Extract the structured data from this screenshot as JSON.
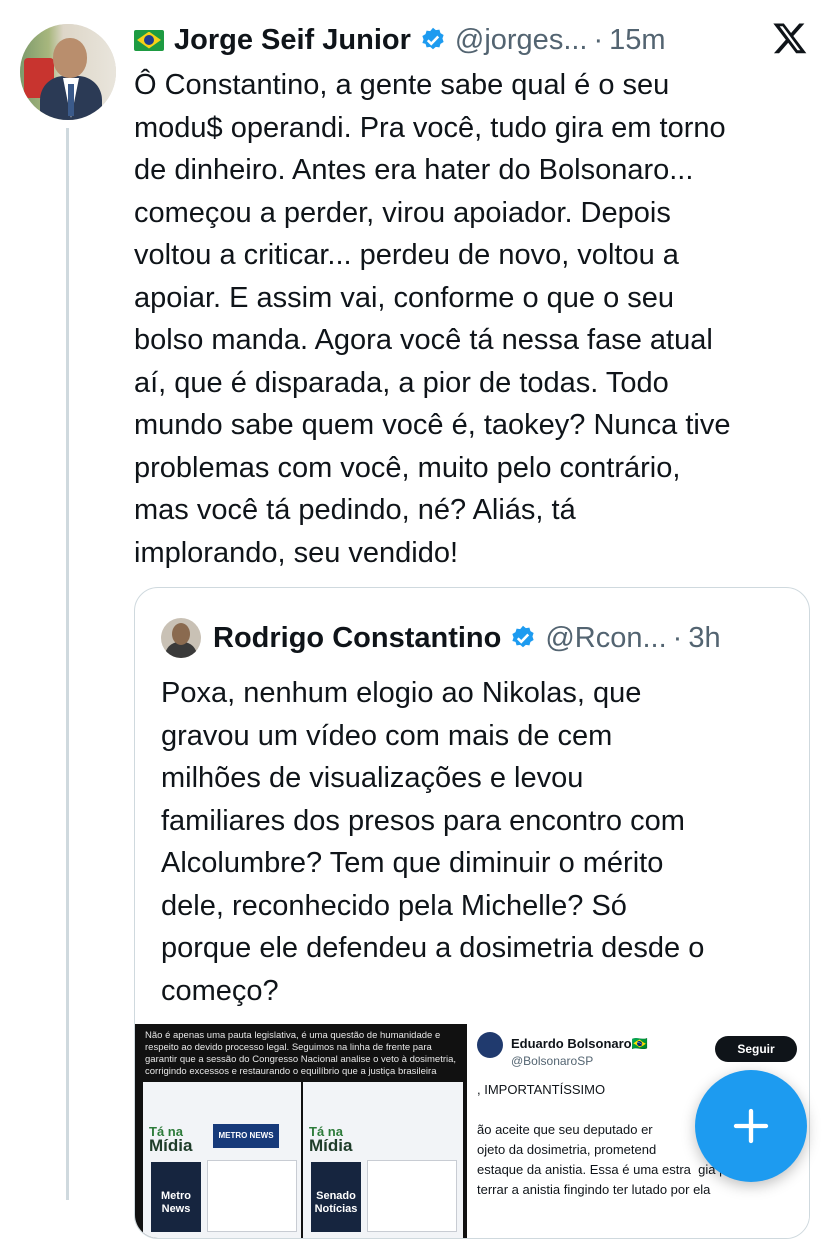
{
  "tweet": {
    "flag": "🇧🇷",
    "author_name": "Jorge Seif Junior",
    "handle": "@jorges...",
    "separator": "·",
    "time": "15m",
    "text": "Ô Constantino, a gente sabe qual é o seu\nmodu$ operandi. Pra você, tudo gira em torno\nde dinheiro. Antes era hater do Bolsonaro...\ncomeçou a perder, virou apoiador. Depois\nvoltou a criticar... perdeu de novo, voltou a\napoiar. E assim vai, conforme o que o seu\nbolso manda. Agora você tá nessa fase atual\naí, que é disparada, a pior de todas. Todo\nmundo sabe quem você é, taokey? Nunca tive\nproblemas com você, muito pelo contrário,\nmas você tá pedindo, né? Aliás, tá\nimplorando, seu vendido!"
  },
  "quote": {
    "author_name": "Rodrigo Constantino",
    "handle": "@Rcon...",
    "separator": "·",
    "time": "3h",
    "text": "Poxa, nenhum elogio ao Nikolas, que\ngravou um vídeo com mais de cem\nmilhões de visualizações e levou\nfamiliares dos presos para encontro com\nAlcolumbre? Tem que diminuir o mérito\ndele, reconhecido pela Michelle? Só\nporque ele defendeu a dosimetria desde o\ncomeço?",
    "media_left": {
      "caption": "Não é apenas uma pauta legislativa, é uma questão de humanidade e respeito ao devido processo legal. Seguimos na linha de frente para garantir que a sessão do Congresso Nacional analise o veto à dosimetria, corrigindo excessos e restaurando o equilíbrio que a justiça brasileira",
      "panel1_ta": "Tá na",
      "panel1_midia": "Mídia",
      "panel1_logo": "METRO NEWS",
      "panel1_source": "Metro News",
      "panel2_ta": "Tá na",
      "panel2_midia": "Mídia",
      "panel2_source": "Senado Notícias"
    },
    "media_right": {
      "name": "Eduardo Bolsonaro🇧🇷",
      "handle": "@BolsonaroSP",
      "follow": "Seguir",
      "title": ", IMPORTANTÍSSIMO",
      "body": "ão aceite que seu deputado er\nojeto da dosimetria, prometend\nestaque da anistia. Essa é uma estra  gia para\nterrar a anistia fingindo ter lutado por ela"
    }
  },
  "icons": {
    "verified": "verified-badge-icon",
    "x_logo": "x-logo-icon",
    "compose": "plus-icon"
  },
  "colors": {
    "accent": "#1d9bf0",
    "text": "#0f1419",
    "secondary": "#536471"
  }
}
